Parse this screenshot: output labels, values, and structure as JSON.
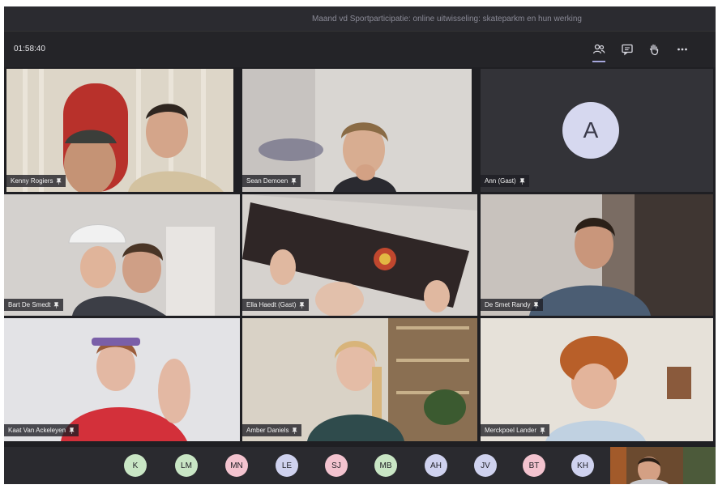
{
  "window": {
    "title": "Maand vd Sportparticipatie: online uitwisseling: skateparkm en hun werking"
  },
  "toolbar": {
    "timer": "01:58:40",
    "buttons": [
      {
        "icon": "participants-icon",
        "active": true
      },
      {
        "icon": "chat-icon",
        "active": false
      },
      {
        "icon": "raise-hand-icon",
        "active": false
      },
      {
        "icon": "more-options-icon",
        "active": false
      }
    ]
  },
  "participants": [
    {
      "name": "Kenny Rogiers",
      "video": true
    },
    {
      "name": "Sean Demoen",
      "video": true
    },
    {
      "name": "Ann (Gast)",
      "video": false,
      "initial": "A"
    },
    {
      "name": "Bart De Smedt",
      "video": true
    },
    {
      "name": "Ella Haedt (Gast)",
      "video": true
    },
    {
      "name": "De Smet Randy",
      "video": true
    },
    {
      "name": "Kaat Van Ackeleyen",
      "video": true
    },
    {
      "name": "Amber Daniels",
      "video": true
    },
    {
      "name": "Merckpoel Lander",
      "video": true
    }
  ],
  "overflow_participants": [
    {
      "initials": "K",
      "color": "#c9e6c5"
    },
    {
      "initials": "LM",
      "color": "#c9e6c5"
    },
    {
      "initials": "MN",
      "color": "#f3c3cf"
    },
    {
      "initials": "LE",
      "color": "#cfd2ef"
    },
    {
      "initials": "SJ",
      "color": "#f3c3cf"
    },
    {
      "initials": "MB",
      "color": "#c9e6c5"
    },
    {
      "initials": "AH",
      "color": "#cfd2ef"
    },
    {
      "initials": "JV",
      "color": "#cfd2ef"
    },
    {
      "initials": "BT",
      "color": "#f3c3cf"
    },
    {
      "initials": "KH",
      "color": "#cfd2ef"
    }
  ]
}
